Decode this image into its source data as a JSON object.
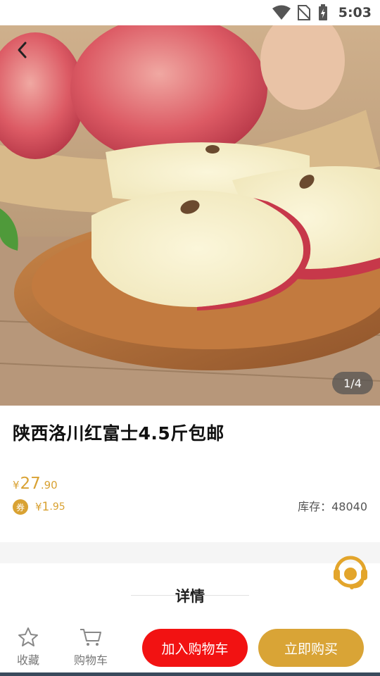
{
  "status_bar": {
    "time": "5:03"
  },
  "hero": {
    "page_indicator": "1/4"
  },
  "product": {
    "title": "陕西洛川红富士4.5斤包邮",
    "price": {
      "currency": "¥",
      "integer": "27",
      "decimal": ".90"
    },
    "points": {
      "badge": "券",
      "currency": "¥",
      "integer": "1",
      "decimal": ".95"
    },
    "stock_label": "库存：48040"
  },
  "details": {
    "title": "详情"
  },
  "bottom_bar": {
    "favorite_label": "收藏",
    "cart_label": "购物车",
    "add_to_cart_label": "加入购物车",
    "buy_now_label": "立即购买"
  },
  "colors": {
    "accent_gold": "#d9a233",
    "add_to_cart_red": "#f21212",
    "buy_now_gold": "#d9a436"
  }
}
